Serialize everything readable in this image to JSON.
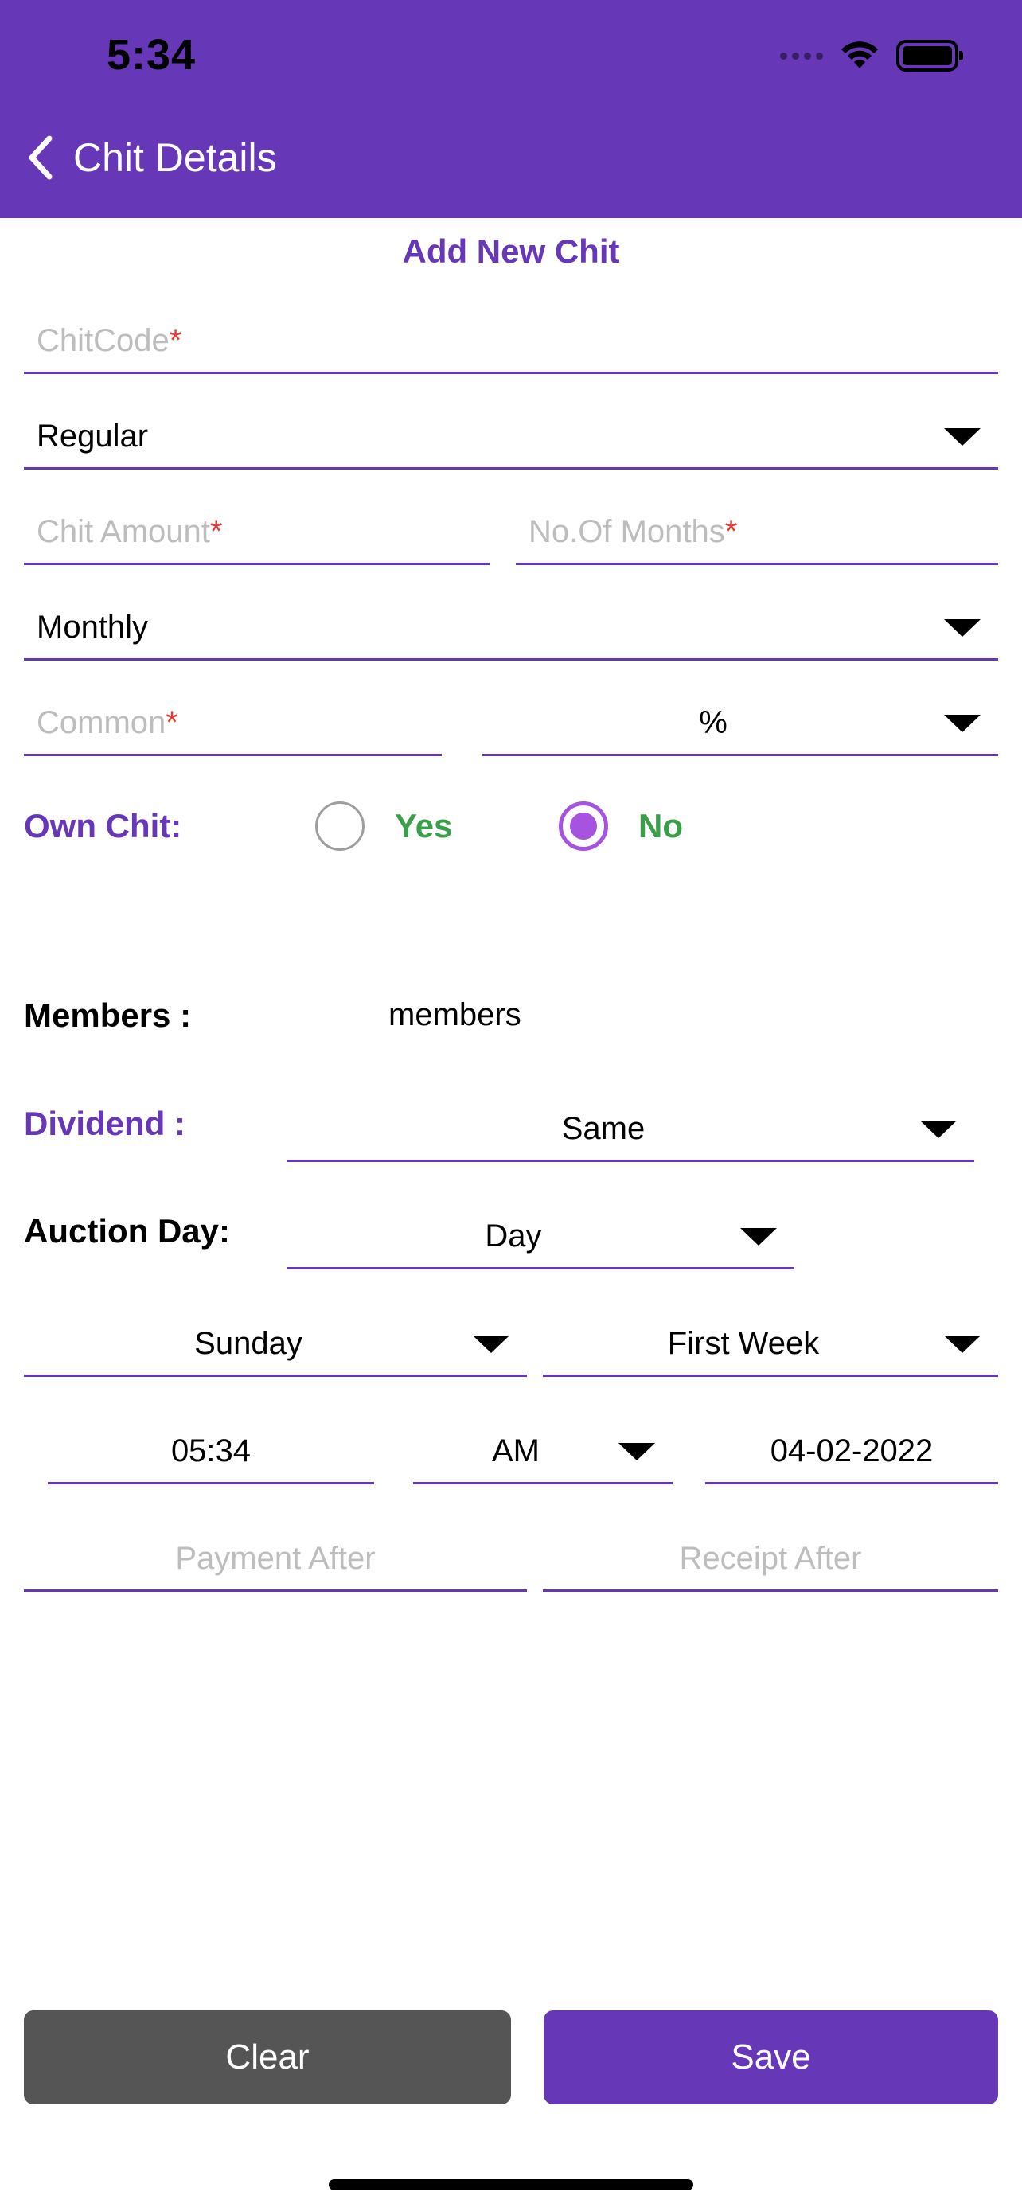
{
  "status_bar": {
    "time": "5:34"
  },
  "header": {
    "title": "Chit Details"
  },
  "form": {
    "heading": "Add New Chit",
    "chit_code": {
      "placeholder": "ChitCode",
      "required_mark": "*"
    },
    "chit_type": {
      "value": "Regular"
    },
    "chit_amount": {
      "placeholder": "Chit Amount",
      "required_mark": "*"
    },
    "no_of_months": {
      "placeholder": "No.Of Months",
      "required_mark": "*"
    },
    "frequency": {
      "value": "Monthly"
    },
    "common": {
      "placeholder": "Common",
      "required_mark": "*"
    },
    "common_unit": {
      "value": "%"
    },
    "own_chit": {
      "label": "Own Chit:",
      "options": [
        {
          "label": "Yes",
          "selected": false
        },
        {
          "label": "No",
          "selected": true
        }
      ]
    },
    "members": {
      "label": "Members :",
      "value": "members"
    },
    "dividend": {
      "label": "Dividend :",
      "value": "Same"
    },
    "auction_day": {
      "label": "Auction Day:",
      "value": "Day"
    },
    "weekday": {
      "value": "Sunday"
    },
    "week": {
      "value": "First Week"
    },
    "time": {
      "value": "05:34"
    },
    "meridiem": {
      "value": "AM"
    },
    "date": {
      "value": "04-02-2022"
    },
    "payment_after": {
      "placeholder": "Payment After"
    },
    "receipt_after": {
      "placeholder": "Receipt After"
    }
  },
  "buttons": {
    "clear": "Clear",
    "save": "Save"
  },
  "colors": {
    "primary": "#6637B7",
    "radio_accent": "#A653E0",
    "option_text": "#3A9E4B",
    "required": "#E53935",
    "clear_button": "#555555"
  }
}
